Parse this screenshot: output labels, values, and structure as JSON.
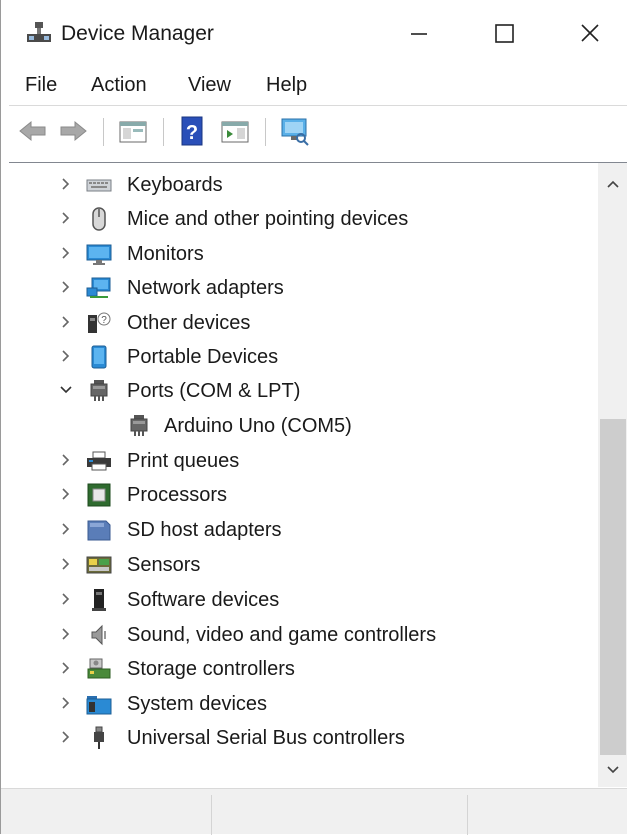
{
  "window": {
    "title": "Device Manager"
  },
  "menu": [
    {
      "label": "File"
    },
    {
      "label": "Action"
    },
    {
      "label": "View"
    },
    {
      "label": "Help"
    }
  ],
  "toolbar": {
    "buttons": [
      "back-arrow-icon",
      "forward-arrow-icon",
      "show-hide-console-tree-icon",
      "help-icon",
      "properties-icon",
      "scan-hardware-changes-icon"
    ]
  },
  "tree": {
    "items": [
      {
        "label": "Keyboards",
        "icon": "keyboard-icon",
        "expanded": false
      },
      {
        "label": "Mice and other pointing devices",
        "icon": "mouse-icon",
        "expanded": false
      },
      {
        "label": "Monitors",
        "icon": "monitor-icon",
        "expanded": false
      },
      {
        "label": "Network adapters",
        "icon": "network-adapter-icon",
        "expanded": false
      },
      {
        "label": "Other devices",
        "icon": "unknown-device-icon",
        "expanded": false
      },
      {
        "label": "Portable Devices",
        "icon": "portable-device-icon",
        "expanded": false
      },
      {
        "label": "Ports (COM & LPT)",
        "icon": "port-icon",
        "expanded": true
      },
      {
        "label": "Arduino Uno (COM5)",
        "icon": "port-icon",
        "child": true
      },
      {
        "label": "Print queues",
        "icon": "printer-icon",
        "expanded": false
      },
      {
        "label": "Processors",
        "icon": "processor-icon",
        "expanded": false
      },
      {
        "label": "SD host adapters",
        "icon": "sd-card-icon",
        "expanded": false
      },
      {
        "label": "Sensors",
        "icon": "sensor-icon",
        "expanded": false
      },
      {
        "label": "Software devices",
        "icon": "software-device-icon",
        "expanded": false
      },
      {
        "label": "Sound, video and game controllers",
        "icon": "speaker-icon",
        "expanded": false
      },
      {
        "label": "Storage controllers",
        "icon": "storage-controller-icon",
        "expanded": false
      },
      {
        "label": "System devices",
        "icon": "system-folder-icon",
        "expanded": false
      },
      {
        "label": "Universal Serial Bus controllers",
        "icon": "usb-icon",
        "expanded": false
      }
    ]
  },
  "colors": {
    "accent_blue": "#2a8ad4",
    "scroll_thumb": "#cdcdcd",
    "chrome": "#f0f0f0"
  }
}
